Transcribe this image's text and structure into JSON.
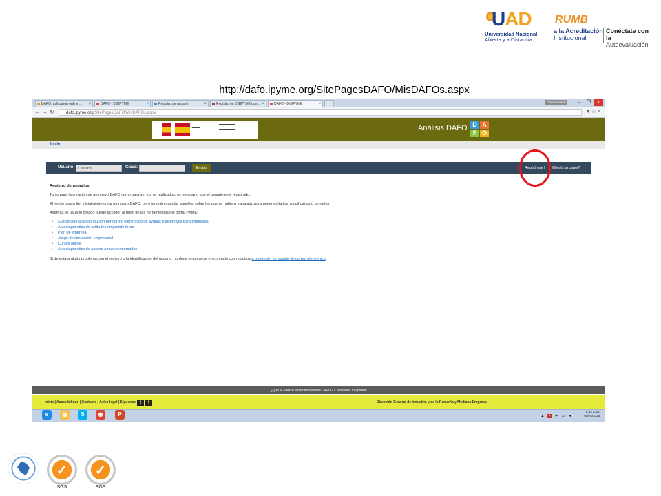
{
  "slide": {
    "url_caption": "http://dafo.ipyme.org/SitePagesDAFO/MisDAFOs.aspx",
    "unad_logo": {
      "name_ad": "AD",
      "line1": "Universidad Nacional",
      "line2": "Abierta y a Distancia"
    },
    "rumbo_logo": {
      "word": "RUMB",
      "line1": "a la Acreditación",
      "line2": "Institucional",
      "right1": "Conéctate con la",
      "right2": "Autoevaluación"
    },
    "badges": [
      {
        "name": "colombia-seal"
      },
      {
        "name": "sgs-cert-1",
        "label": "SGS"
      },
      {
        "name": "sgs-cert-2",
        "label": "SGS"
      }
    ]
  },
  "browser": {
    "tabs": [
      {
        "label": "DAFO: aplicación online ...",
        "active": false,
        "color": "#f39c12"
      },
      {
        "label": "DAFO - DGIPYME",
        "active": false,
        "color": "#e74c3c"
      },
      {
        "label": "Registro de usuario",
        "active": false,
        "color": "#3498db"
      },
      {
        "label": "Registro en DGIPYME con...",
        "active": false,
        "color": "#c0392b"
      },
      {
        "label": "DAFO - DGIPYME",
        "active": true,
        "color": "#e74c3c"
      }
    ],
    "user_chip": "Carlos Wilson",
    "address": {
      "host": "dafo.ipyme.org",
      "path": "/SitePagesDAFO/MisDAFOs.aspx"
    }
  },
  "site": {
    "title": "Análisis DAFO",
    "dafo_tiles": [
      "D",
      "A",
      "F",
      "O"
    ],
    "dafo_colors": [
      "#3a9bd9",
      "#e8722c",
      "#8cc63f",
      "#f0b323"
    ],
    "breadcrumb": "Inicio",
    "login": {
      "usuario_label": "Usuario:",
      "usuario_value": "Usuario",
      "clave_label": "Clave:",
      "enviar": "Enviar",
      "registrese": "Regístrese |",
      "olvido": "Olvidó su clave?"
    },
    "content": {
      "title": "Registro de usuarios",
      "p1": "Tanto para la creación de un nuevo DAFO como para ver los ya realizados, es necesario que el usuario esté registrado.",
      "p2": "El registro permite, inicialmente crear un nuevo DAFO, pero también guardar aquellos sobre los que se hubiera trabajado para poder editarlos, modificarlos o borrarlos.",
      "p3": "Además, el usuario creado puede acceder al resto de las herramientas del portal PYME:",
      "list": [
        "Suscripción a la distribución por correo electrónico de ayudas e incentivos para empresas",
        "Autodiagnóstico de actitudes emprendedoras",
        "Plan de empresa",
        "Juego de simulación empresarial",
        "Cursos online",
        "Autodiagnóstico de acceso a nuevos mercados"
      ],
      "p4_prefix": "Si detectara algún problema con el registro o la identificación del usuario, no dude en ponerse en contacto con nosotros",
      "p4_link": "a través del formulario de correo electrónico"
    },
    "feedback": "¿Qué le parece esta herramienta DAFO? Cuéntenos tu opinión",
    "footer_links": "Inicio | Accesibilidad | Contacto | Aviso legal | Síguenos",
    "footer_right": "Dirección General de Industria y de la Pequeña y Mediana Empresa"
  },
  "taskbar": {
    "apps": [
      {
        "name": "ie",
        "glyph": "e",
        "color": "#1e88e5"
      },
      {
        "name": "explorer",
        "glyph": "▤",
        "color": "#f2c14e"
      },
      {
        "name": "skype",
        "glyph": "S",
        "color": "#00aff0"
      },
      {
        "name": "chrome",
        "glyph": "◉",
        "color": "#db4437"
      },
      {
        "name": "powerpoint",
        "glyph": "P",
        "color": "#d24726"
      }
    ],
    "time": "8:54 a. m.",
    "date": "08/04/2016"
  }
}
